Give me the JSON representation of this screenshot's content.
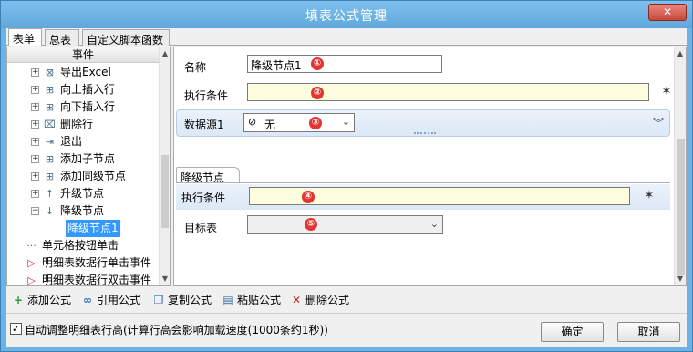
{
  "window": {
    "title": "填表公式管理",
    "close_glyph": "✕"
  },
  "tabs": [
    {
      "label": "表单",
      "active": true
    },
    {
      "label": "总表",
      "active": false
    },
    {
      "label": "自定义脚本函数",
      "active": false
    }
  ],
  "tree": {
    "header": "事件",
    "items": [
      {
        "label": "导出Excel",
        "icon": "excel-icon",
        "glyph": "⊠",
        "expander": "+"
      },
      {
        "label": "向上插入行",
        "icon": "insert-row-up-icon",
        "glyph": "⊞",
        "expander": "+"
      },
      {
        "label": "向下插入行",
        "icon": "insert-row-down-icon",
        "glyph": "⊞",
        "expander": "+"
      },
      {
        "label": "删除行",
        "icon": "delete-row-icon",
        "glyph": "⌧",
        "expander": "+"
      },
      {
        "label": "退出",
        "icon": "exit-icon",
        "glyph": "⇥",
        "expander": "+"
      },
      {
        "label": "添加子节点",
        "icon": "add-child-node-icon",
        "glyph": "⊞",
        "expander": "+"
      },
      {
        "label": "添加同级节点",
        "icon": "add-sibling-node-icon",
        "glyph": "⊞",
        "expander": "+"
      },
      {
        "label": "升级节点",
        "icon": "arrow-up-icon",
        "glyph": "↑",
        "expander": "+"
      },
      {
        "label": "降级节点",
        "icon": "arrow-down-icon",
        "glyph": "↓",
        "expander": "−"
      },
      {
        "label": "降级节点1",
        "selected": true
      },
      {
        "label": "单元格按钮单击",
        "icon": "dots-icon",
        "glyph": "···"
      },
      {
        "label": "明细表数据行单击事件",
        "icon": "flag-icon",
        "glyph": "▷"
      },
      {
        "label": "明细表数据行双击事件",
        "icon": "flag-icon",
        "glyph": "▷"
      }
    ]
  },
  "form": {
    "name_label": "名称",
    "name_value": "降级节点1",
    "condition_label": "执行条件",
    "datasource_label": "数据源1",
    "datasource_value": "无",
    "section_title": "降级节点",
    "condition2_label": "执行条件",
    "target_label": "目标表",
    "target_value": "",
    "badges": [
      "①",
      "②",
      "③",
      "④",
      "⑤"
    ]
  },
  "toolbar": [
    {
      "label": "添加公式",
      "icon": "add-icon",
      "glyph": "+",
      "color": "#2e9b2e"
    },
    {
      "label": "引用公式",
      "icon": "link-icon",
      "glyph": "∞",
      "color": "#2c6fb5"
    },
    {
      "label": "复制公式",
      "icon": "copy-icon",
      "glyph": "❐",
      "color": "#3a6ea5"
    },
    {
      "label": "粘贴公式",
      "icon": "paste-icon",
      "glyph": "▤",
      "color": "#3a6ea5"
    },
    {
      "label": "删除公式",
      "icon": "delete-icon",
      "glyph": "✕",
      "color": "#d11e1e"
    }
  ],
  "footer": {
    "auto_height_checked": true,
    "auto_height_label": "自动调整明细表行高(计算行高会影响加载速度(1000条约1秒))",
    "ok_label": "确定",
    "cancel_label": "取消"
  },
  "colors": {
    "titlebar": "#6cb2e4",
    "selection": "#3399ff",
    "badge": "#e3342f",
    "condition_field": "#fffde0"
  }
}
